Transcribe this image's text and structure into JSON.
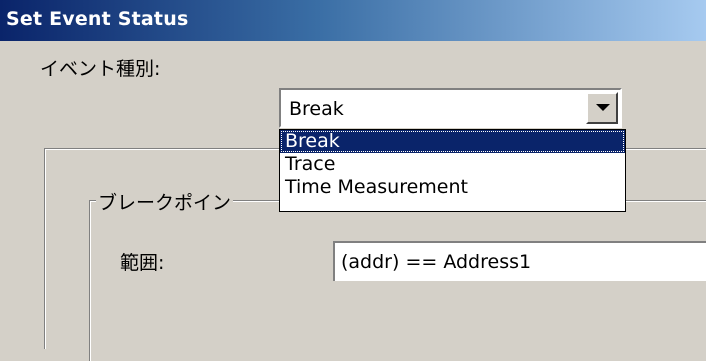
{
  "window": {
    "title": "Set Event Status"
  },
  "form": {
    "event_type_label": "イベント種別:",
    "event_type_value": "Break",
    "dropdown_options": [
      "Break",
      "Trace",
      "Time Measurement"
    ],
    "dropdown_selected_index": 0,
    "group_caption": "ブレークポイン",
    "range_label": "範囲:",
    "range_value": "(addr) == Address1"
  },
  "colors": {
    "titlebar_start": "#0a246a",
    "titlebar_end": "#a6caf0",
    "selection": "#0a246a",
    "dialog_bg": "#d4d0c8"
  }
}
